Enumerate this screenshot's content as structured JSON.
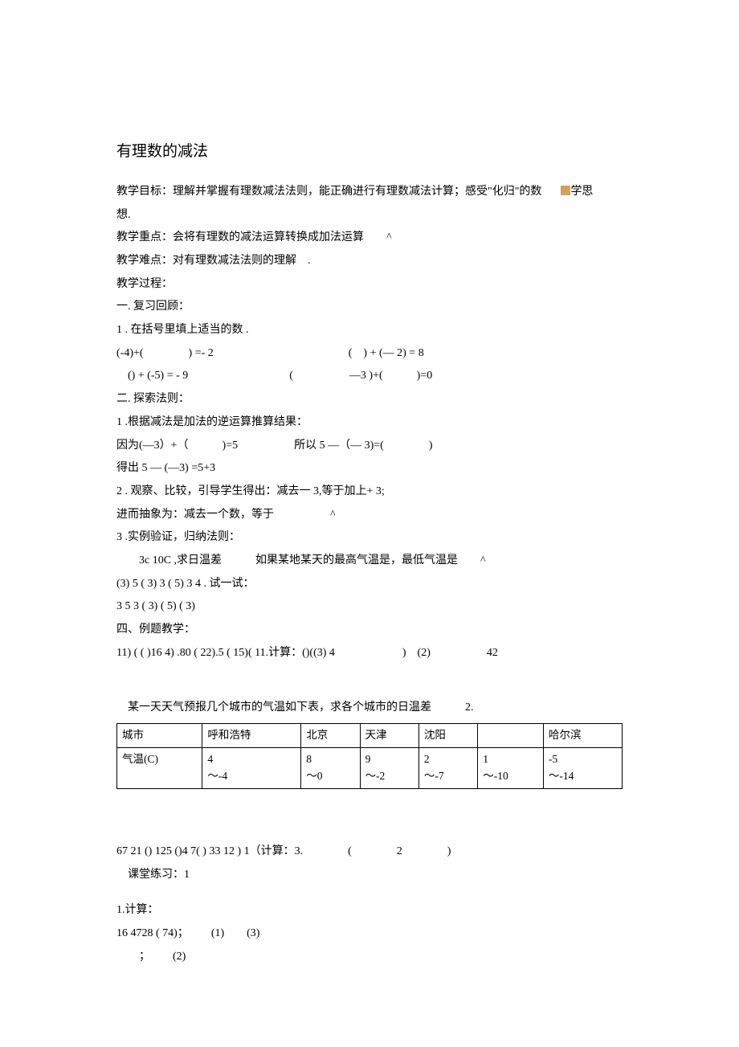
{
  "title": "有理数的减法",
  "p1a": "教学目标：理解并掌握有理数减法法则，能正确进行有理数减法计算；感受\"化归\"的数",
  "p1b": "学思",
  "p1c": "想.",
  "p2": "教学重点：会将有理数的减法运算转换成加法运算  ^",
  "p3": "教学难点：对有理数减法法则的理解 .",
  "p4": "教学过程：",
  "p5": "一. 复习回顾：",
  "p6": "1 . 在括号里填上适当的数 .",
  "p7": "(-4)+(    ) =- 2            ( ) + (— 2) = 8",
  "p8": " () + (-5) = - 9         (     —3 )+(   )=0",
  "p9": "二. 探索法则：",
  "p10": "1 .根据减法是加法的逆运算推算结果：",
  "p11": "因为(—3）+（   )=5     所以 5 —（— 3)=(    )",
  "p12": "得出 5 — (—3) =5+3",
  "p13": "2 . 观察、比较，引导学生得出：减去一 3,等于加上+ 3;",
  "p14": "进而抽象为：减去一个数，等于     ^",
  "p15": "3 .实例验证，归纳法则：",
  "p16": "  3c 10C ,求日温差   如果某地某天的最高气温是，最低气温是  ^",
  "p17": "(3) 5 ( 3) 3 ( 5) 3 4 . 试一试：",
  "p18": "3 5 3 ( 3) ( 5) ( 3)",
  "p19": "四、例题教学：",
  "p20": "11) ( ( )16 4) .80 ( 22).5 ( 15)( 11.计算：()((3) 4      ) (2)     42",
  "p21": " 某一天天气预报几个城市的气温如下表，求各个城市的日温差   2.",
  "table": {
    "h0": "城市",
    "h1": "呼和浩特",
    "h2": "北京",
    "h3": "天津",
    "h4": "沈阳",
    "h5": "",
    "h6": "哈尔滨",
    "r0": "气温(C)",
    "r1a": "4",
    "r1b": "〜-4",
    "r2a": "8",
    "r2b": "〜0",
    "r3a": "9",
    "r3b": "〜-2",
    "r4a": "2",
    "r4b": "〜-7",
    "r5a": "1",
    "r5b": "〜-10",
    "r6a": "-5",
    "r6b": "〜-14"
  },
  "p22": "67 21 () 125 ()4 7( ) 33 12 ) 1（计算：3.    (    2    )",
  "p23": " 课堂练习：1",
  "p24": "1.计算：",
  "p25": "16 4728 ( 74)；  (1)  (3)",
  "p26": "  ；  (2)"
}
